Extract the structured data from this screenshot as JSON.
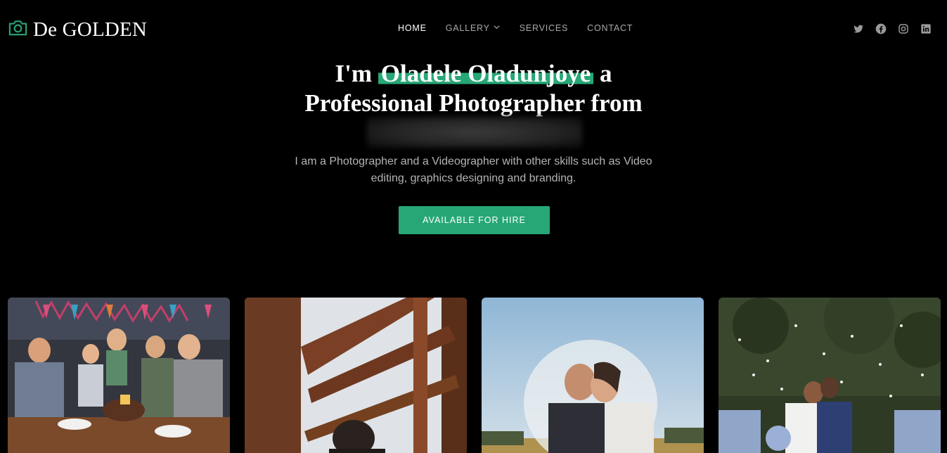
{
  "brand": {
    "name": "De GOLDEN",
    "icon": "camera-icon",
    "accent": "#27a776"
  },
  "nav": {
    "items": [
      {
        "label": "HOME",
        "active": true
      },
      {
        "label": "GALLERY",
        "dropdown": true
      },
      {
        "label": "SERVICES"
      },
      {
        "label": "CONTACT"
      }
    ]
  },
  "social": [
    "twitter-icon",
    "facebook-icon",
    "instagram-icon",
    "linkedin-icon"
  ],
  "hero": {
    "title_prefix": "I'm",
    "name": "Oladele Oladunjoye",
    "title_suffix": "a",
    "title_line2": "Professional Photographer from",
    "description_line1": "I am a Photographer and a Videographer with other skills such as Video",
    "description_line2": "editing, graphics designing and branding.",
    "cta": "AVAILABLE FOR HIRE"
  },
  "gallery": [
    {
      "subject": "birthday-party-photo"
    },
    {
      "subject": "staircase-portrait-photo"
    },
    {
      "subject": "wedding-couple-veil-photo"
    },
    {
      "subject": "wedding-celebration-photo"
    }
  ]
}
